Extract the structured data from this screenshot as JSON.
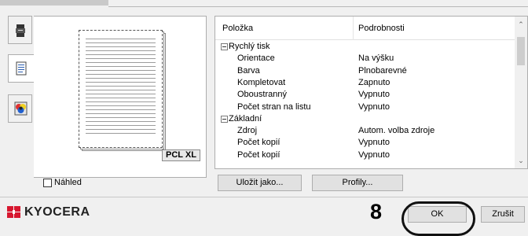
{
  "list": {
    "header": {
      "col1": "Položka",
      "col2": "Podrobnosti"
    },
    "rows": [
      {
        "type": "group",
        "name": "Rychlý tisk",
        "value": ""
      },
      {
        "type": "item",
        "name": "Orientace",
        "value": "Na výšku"
      },
      {
        "type": "item",
        "name": "Barva",
        "value": "Plnobarevné"
      },
      {
        "type": "item",
        "name": "Kompletovat",
        "value": "Zapnuto"
      },
      {
        "type": "item",
        "name": "Oboustranný",
        "value": "Vypnuto"
      },
      {
        "type": "item",
        "name": "Počet stran na listu",
        "value": "Vypnuto"
      },
      {
        "type": "group",
        "name": "Základní",
        "value": ""
      },
      {
        "type": "item",
        "name": "Zdroj",
        "value": "Autom. volba zdroje"
      },
      {
        "type": "item",
        "name": "Počet kopií",
        "value": "Vypnuto"
      },
      {
        "type": "item",
        "name": "Počet kopií",
        "value": "Vypnuto"
      }
    ]
  },
  "preview": {
    "pdl_label": "PCL XL"
  },
  "options": {
    "preview_label": "Náhled"
  },
  "buttons": {
    "save_as": "Uložit jako...",
    "profiles": "Profily...",
    "ok": "OK",
    "cancel": "Zrušit"
  },
  "brand": {
    "name": "KYOCERA",
    "color": "#d7172f"
  },
  "annotation": {
    "step": "8"
  },
  "icons": {
    "tab1": "printer-icon",
    "tab2": "document-icon",
    "tab3": "color-icon",
    "scroll_up": "chevron-up-icon",
    "scroll_down": "chevron-down-icon"
  }
}
